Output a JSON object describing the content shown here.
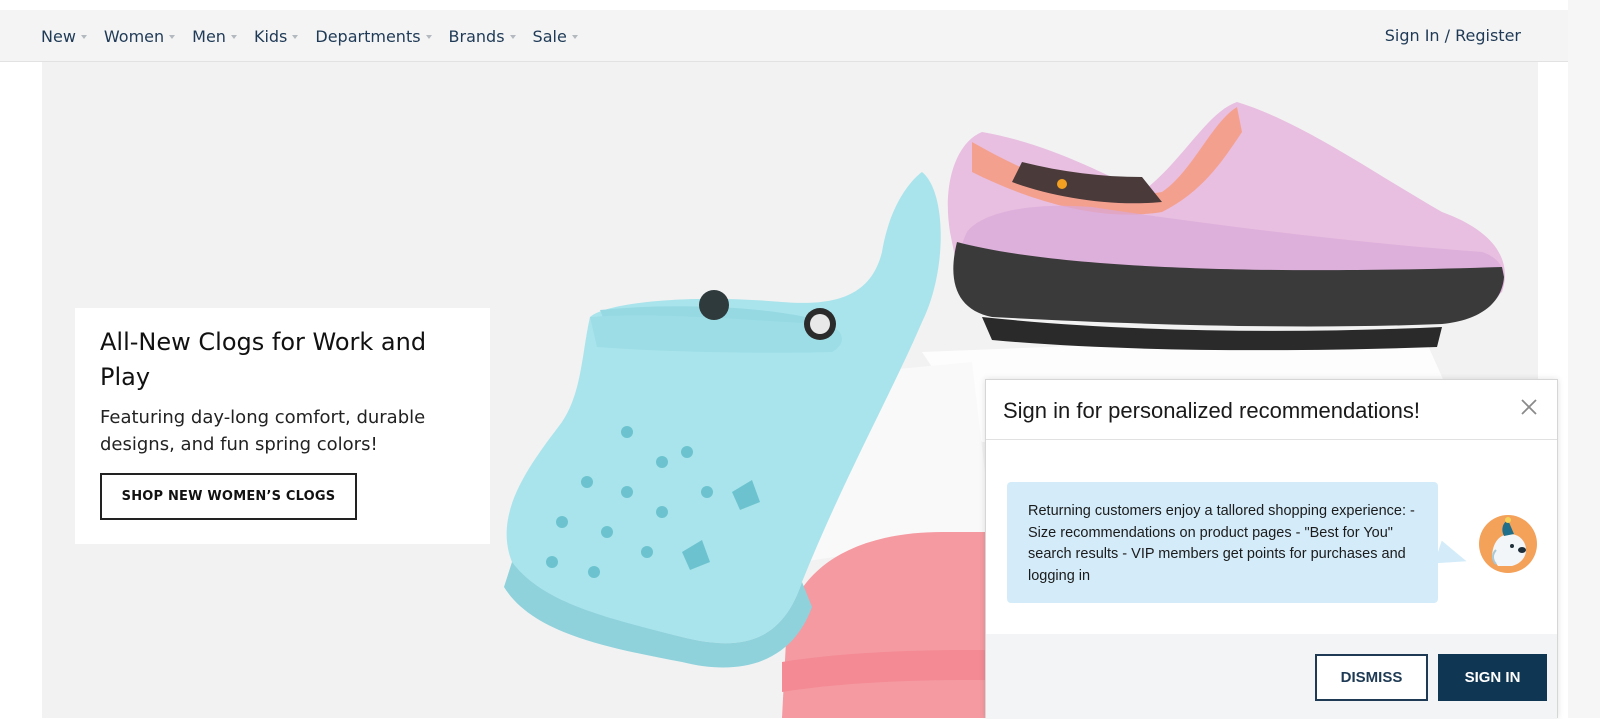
{
  "nav": {
    "items": [
      {
        "label": "New"
      },
      {
        "label": "Women"
      },
      {
        "label": "Men"
      },
      {
        "label": "Kids"
      },
      {
        "label": "Departments"
      },
      {
        "label": "Brands"
      },
      {
        "label": "Sale"
      }
    ],
    "signin_label": "Sign In / Register"
  },
  "hero": {
    "title": "All-New Clogs for Work and Play",
    "subtitle": "Featuring day-long comfort, durable designs, and fun spring colors!",
    "cta_label": "SHOP NEW WOMEN’S CLOGS",
    "colors": {
      "background": "#f2f2f2",
      "clog_blue": "#a9e4ec",
      "clog_pink": "#f59aa1",
      "loafer_trim": "#f4a08f"
    }
  },
  "popup": {
    "title": "Sign in for personalized recommendations!",
    "message": "Returning customers enjoy a tallored shopping experience: - Size recommendations on product pages - \"Best for You\" search results - VIP members get points for purchases and logging in",
    "dismiss_label": "DISMISS",
    "signin_label": "SIGN IN",
    "colors": {
      "bubble": "#d4ecfa",
      "primary_button": "#0f3652"
    },
    "icons": {
      "close": "close-icon",
      "mascot": "mascot-dog-icon"
    }
  }
}
